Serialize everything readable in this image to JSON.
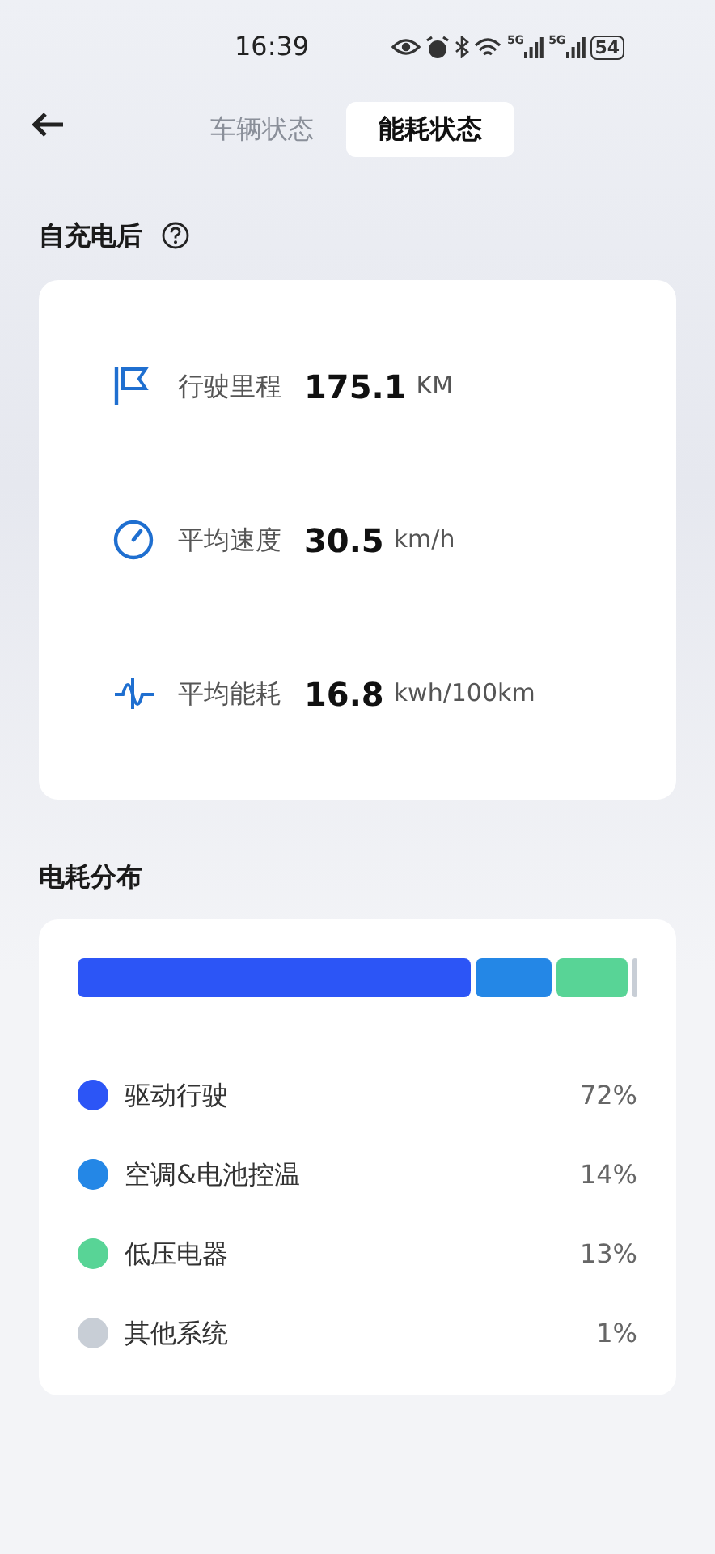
{
  "status_bar": {
    "time": "16:39",
    "network_labels": [
      "5G",
      "5G"
    ],
    "battery": "54"
  },
  "tabs": [
    {
      "label": "车辆状态",
      "selected": false
    },
    {
      "label": "能耗状态",
      "selected": true
    }
  ],
  "summary": {
    "title": "自充电后",
    "metrics": [
      {
        "kind": "distance",
        "label": "行驶里程",
        "value": "175.1",
        "unit": "KM"
      },
      {
        "kind": "speed",
        "label": "平均速度",
        "value": "30.5",
        "unit": "km/h"
      },
      {
        "kind": "consumption",
        "label": "平均能耗",
        "value": "16.8",
        "unit": "kwh/100km"
      }
    ]
  },
  "breakdown": {
    "title": "电耗分布",
    "items": [
      {
        "label": "驱动行驶",
        "percent": "72%",
        "color": "#2c55f6"
      },
      {
        "label": "空调&电池控温",
        "percent": "14%",
        "color": "#2487e6"
      },
      {
        "label": "低压电器",
        "percent": "13%",
        "color": "#58d496"
      },
      {
        "label": "其他系统",
        "percent": "1%",
        "color": "#c8ced6"
      }
    ]
  }
}
